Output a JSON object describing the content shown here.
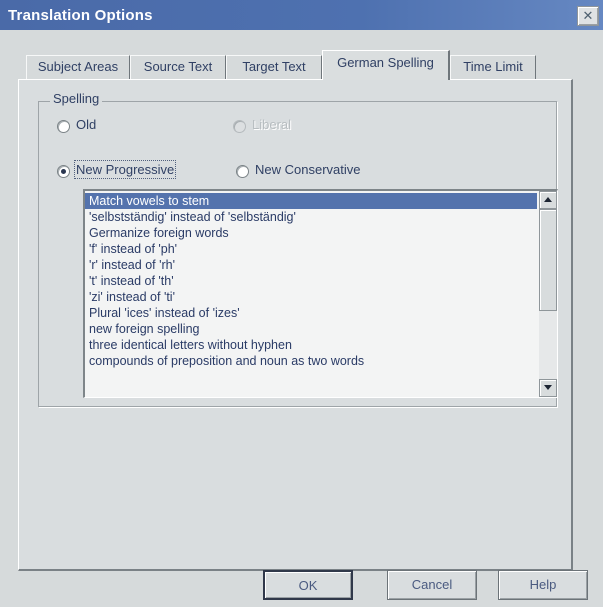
{
  "window": {
    "title": "Translation Options",
    "close_glyph": "✕"
  },
  "tabs": [
    {
      "label": "Subject Areas",
      "active": false
    },
    {
      "label": "Source Text",
      "active": false
    },
    {
      "label": "Target Text",
      "active": false
    },
    {
      "label": "German Spelling",
      "active": true
    },
    {
      "label": "Time Limit",
      "active": false
    }
  ],
  "spelling": {
    "group_label": "Spelling",
    "options": [
      {
        "label": "Old",
        "checked": false,
        "enabled": true
      },
      {
        "label": "Liberal",
        "checked": false,
        "enabled": false
      },
      {
        "label": "New Progressive",
        "checked": true,
        "enabled": true
      },
      {
        "label": "New Conservative",
        "checked": false,
        "enabled": true
      }
    ]
  },
  "rules_list": {
    "selected_index": 0,
    "items": [
      "Match vowels to stem",
      "'selbstständig' instead of 'selbständig'",
      "Germanize foreign words",
      "'f' instead of 'ph'",
      "'r' instead of 'rh'",
      "'t' instead of 'th'",
      "'zi' instead of 'ti'",
      "Plural 'ices' instead of 'izes'",
      "new foreign spelling",
      "three identical letters without hyphen",
      "compounds of preposition and noun as two words"
    ]
  },
  "buttons": {
    "ok": "OK",
    "cancel": "Cancel",
    "help": "Help"
  },
  "icons": {
    "close": "close-icon",
    "scroll_up": "arrow-up-icon",
    "scroll_down": "arrow-down-icon"
  }
}
